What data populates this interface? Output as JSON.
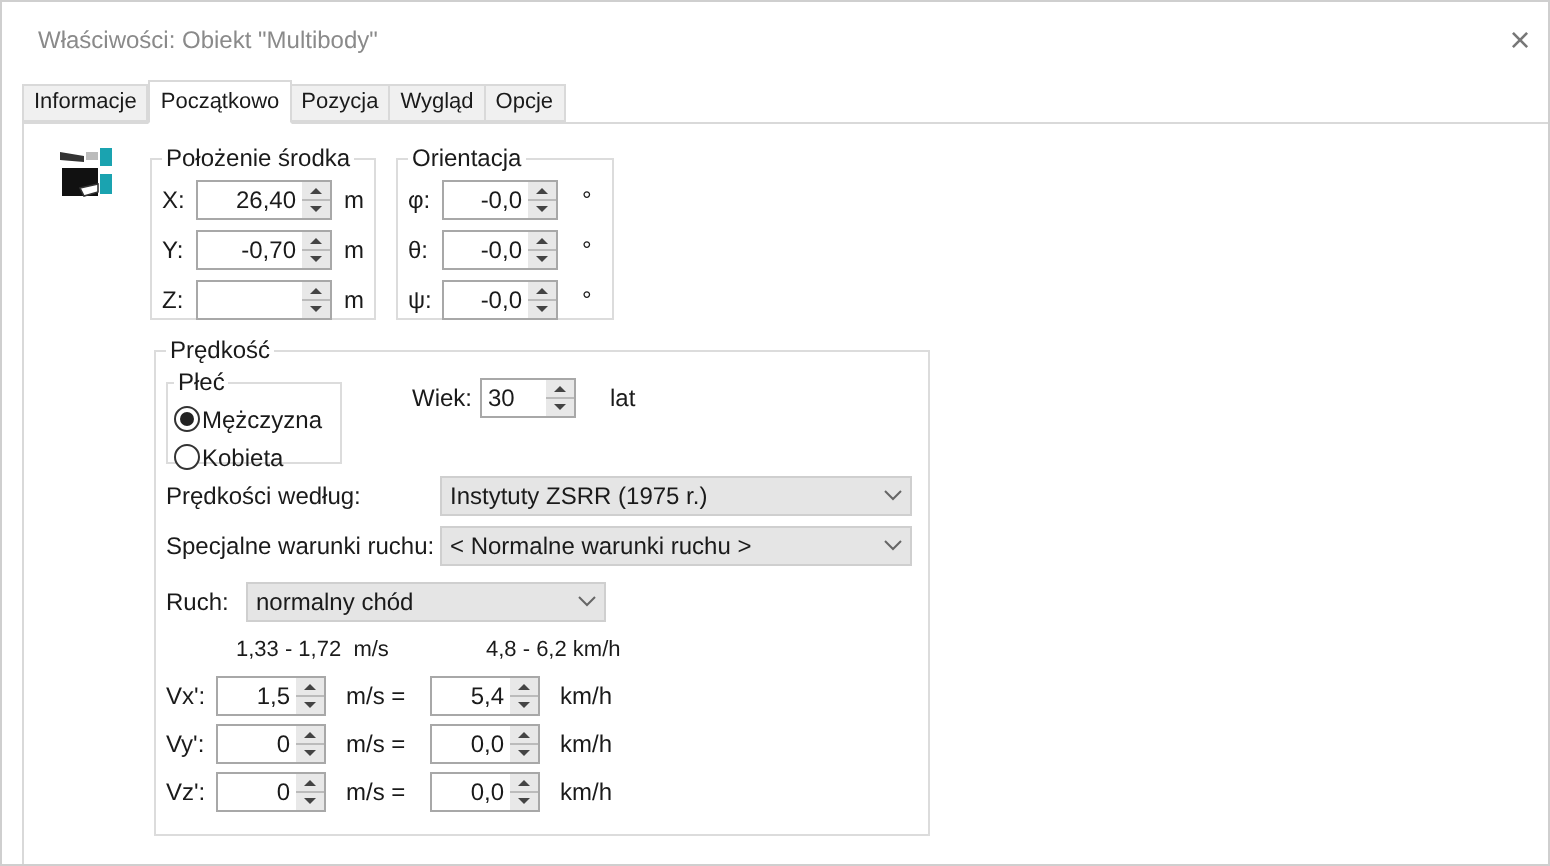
{
  "window": {
    "title": "Właściwości: Obiekt \"Multibody\"",
    "close": "×"
  },
  "tabs": [
    {
      "label": "Informacje",
      "selected": false
    },
    {
      "label": "Początkowo",
      "selected": true
    },
    {
      "label": "Pozycja",
      "selected": false
    },
    {
      "label": "Wygląd",
      "selected": false
    },
    {
      "label": "Opcje",
      "selected": false
    }
  ],
  "position_group": {
    "title": "Położenie środka",
    "fields": [
      {
        "label": "X:",
        "value": "26,40",
        "unit": "m"
      },
      {
        "label": "Y:",
        "value": "-0,70",
        "unit": "m"
      },
      {
        "label": "Z:",
        "unit": "m"
      }
    ]
  },
  "orientation_group": {
    "title": "Orientacja",
    "fields": [
      {
        "label": "φ:",
        "value": "-0,0",
        "unit": "°"
      },
      {
        "label": "θ:",
        "value": "-0,0",
        "unit": "°"
      },
      {
        "label": "ψ:",
        "value": "-0,0",
        "unit": "°"
      }
    ]
  },
  "speed_group": {
    "title": "Prędkość",
    "gender": {
      "title": "Płeć",
      "options": [
        {
          "label": "Mężczyzna",
          "selected": true
        },
        {
          "label": "Kobieta",
          "selected": false
        }
      ]
    },
    "age": {
      "label": "Wiek:",
      "value": "30",
      "unit": "lat"
    },
    "speed_source": {
      "label": "Prędkości według:",
      "value": "Instytuty ZSRR (1975 r.)"
    },
    "special_conditions": {
      "label": "Specjalne warunki ruchu:",
      "value": "< Normalne warunki ruchu >"
    },
    "motion": {
      "label": "Ruch:",
      "value": "normalny chód"
    },
    "range_ms": "1,33 - 1,72  m/s",
    "range_kmh": "4,8 - 6,2 km/h",
    "velocities": [
      {
        "label": "Vx':",
        "ms": "1,5",
        "ms_unit": "m/s =",
        "kmh": "5,4",
        "kmh_unit": "km/h"
      },
      {
        "label": "Vy':",
        "ms": "0",
        "ms_unit": "m/s =",
        "kmh": "0,0",
        "kmh_unit": "km/h"
      },
      {
        "label": "Vz':",
        "ms": "0",
        "ms_unit": "m/s =",
        "kmh": "0,0",
        "kmh_unit": "km/h"
      }
    ]
  }
}
